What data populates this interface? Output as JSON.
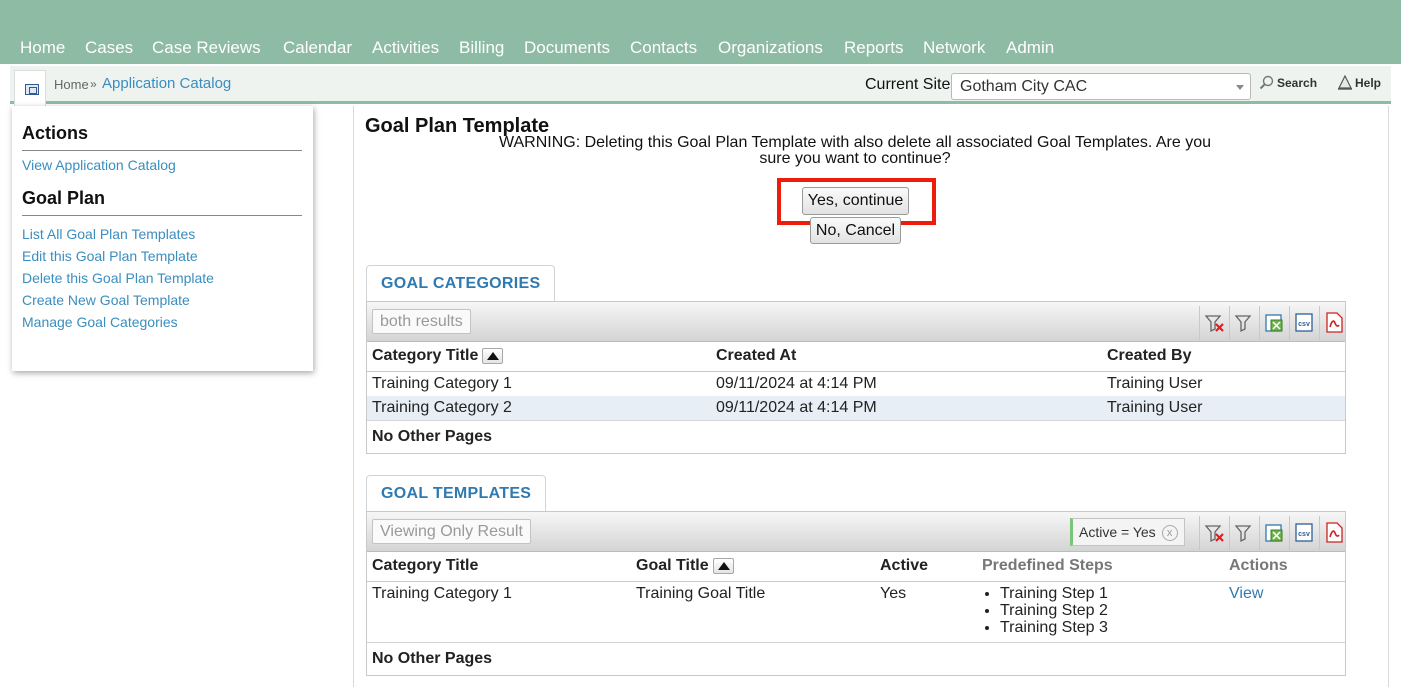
{
  "topnav": {
    "items": [
      "Home",
      "Cases",
      "Case Reviews",
      "Calendar",
      "Activities",
      "Billing",
      "Documents",
      "Contacts",
      "Organizations",
      "Reports",
      "Network",
      "Admin"
    ]
  },
  "breadcrumb": {
    "home": "Home",
    "separator": "»",
    "current": "Application Catalog"
  },
  "site": {
    "label": "Current Site",
    "selected": "Gotham City CAC"
  },
  "tools": {
    "search": "Search",
    "help": "Help"
  },
  "sidebar": {
    "actions_heading": "Actions",
    "actions": [
      "View Application Catalog"
    ],
    "goal_plan_heading": "Goal Plan",
    "goal_plan_links": [
      "List All Goal Plan Templates",
      "Edit this Goal Plan Template",
      "Delete this Goal Plan Template",
      "Create New Goal Template",
      "Manage Goal Categories"
    ]
  },
  "main": {
    "title": "Goal Plan Template",
    "warning": "WARNING: Deleting this Goal Plan Template with also delete all associated Goal Templates. Are you sure you want to continue?",
    "confirm_label": "Yes, continue",
    "cancel_label": "No, Cancel"
  },
  "colors": {
    "nav_bg": "#8dbba3",
    "link": "#3a8ec0",
    "highlight": "#ee1c0b"
  },
  "goal_categories": {
    "tab": "GOAL CATEGORIES",
    "results_label": "both results",
    "columns": [
      "Category Title",
      "Created At",
      "Created By"
    ],
    "rows": [
      [
        "Training Category 1",
        "09/11/2024 at 4:14 PM",
        "Training User"
      ],
      [
        "Training Category 2",
        "09/11/2024 at 4:14 PM",
        "Training User"
      ]
    ],
    "footer": "No Other Pages"
  },
  "goal_templates": {
    "tab": "GOAL TEMPLATES",
    "results_label": "Viewing Only Result",
    "filter": "Active = Yes",
    "filter_remove": "x",
    "columns": [
      "Category Title",
      "Goal Title",
      "Active",
      "Predefined Steps",
      "Actions"
    ],
    "rows": [
      {
        "category": "Training Category 1",
        "goal": "Training Goal Title",
        "active": "Yes",
        "steps": [
          "Training Step 1",
          "Training Step 2",
          "Training Step 3"
        ],
        "action": "View"
      }
    ],
    "footer": "No Other Pages"
  },
  "toolbar_icons": [
    "clear-filters-icon",
    "filter-icon",
    "excel-export-icon",
    "csv-export-icon",
    "pdf-export-icon"
  ]
}
